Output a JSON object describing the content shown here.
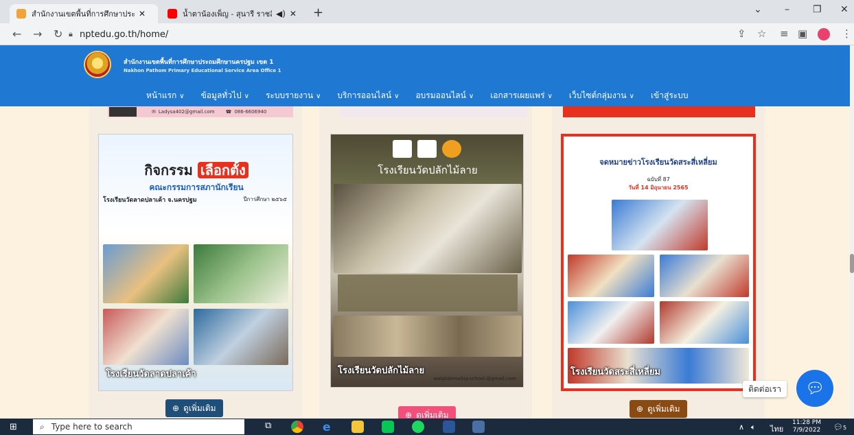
{
  "browser": {
    "tabs": [
      {
        "label": "สำนักงานเขตพื้นที่การศึกษาประถมศึก",
        "favicon_color": "#f2a33a"
      },
      {
        "label": "น้ำตาน้องเพ็ญ - สุนารี ราชสีมา [",
        "favicon_color": "#ff0000"
      }
    ],
    "url": "nptedu.go.th/home/"
  },
  "site": {
    "org_name_th": "สำนักงานเขตพื้นที่การศึกษาประถมศึกษานครปฐม เขต 1",
    "org_name_en": "Nakhon Pathom Primary Educational Service Area Office 1",
    "menu": [
      {
        "label": "หน้าแรก",
        "dropdown": true
      },
      {
        "label": "ข้อมูลทั่วไป",
        "dropdown": true
      },
      {
        "label": "ระบบรายงาน",
        "dropdown": true
      },
      {
        "label": "บริการออนไลน์",
        "dropdown": true
      },
      {
        "label": "อบรมออนไลน์",
        "dropdown": true
      },
      {
        "label": "เอกสารเผยแพร่",
        "dropdown": true
      },
      {
        "label": "เว็บไซต์กลุ่มงาน",
        "dropdown": true
      },
      {
        "label": "เข้าสู่ระบบ",
        "dropdown": false
      }
    ],
    "top_strip": {
      "email": "Ladysa402@gmail.com",
      "phone": "086-6606940"
    }
  },
  "cards": [
    {
      "label": "โรงเรียนวัดลาดปลาเค้า",
      "headline": "กิจกรรม",
      "headline_highlight": "เลือกตั้ง",
      "subheading": "คณะกรรมการสภานักเรียน",
      "school_line": "โรงเรียนวัดลาดปลาเค้า จ.นครปฐม",
      "year": "ปีการศึกษา ๒๕๖๕",
      "more": "ดูเพิ่มเติม",
      "button_color": "#1f4e79"
    },
    {
      "label": "โรงเรียนวัดปลักไม้ลาย",
      "headline": "โรงเรียนวัดปลักไม้ลาย",
      "footer": "watplakmailay.school.@gmail.com",
      "more": "ดูเพิ่มเติม",
      "button_color": "#f0507a"
    },
    {
      "label": "โรงเรียนวัดสระสี่เหลี่ยม",
      "headline": "จดหมายข่าวโรงเรียนวัดสระสี่เหลี่ยม",
      "issue": "ฉบับที่ 87",
      "date": "วันที่ 14 มิถุนายน 2565",
      "more": "ดูเพิ่มเติม",
      "button_color": "#8a4a12"
    }
  ],
  "chat": {
    "label": "ติดต่อเรา"
  },
  "taskbar": {
    "search_placeholder": "Type here to search",
    "lang": "ไทย",
    "time": "11:28 PM",
    "date": "7/9/2022",
    "notif_count": "5"
  }
}
